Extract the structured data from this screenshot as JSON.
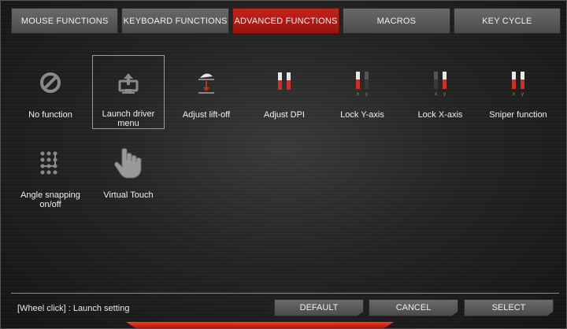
{
  "tabs": [
    {
      "label": "MOUSE FUNCTIONS",
      "active": false
    },
    {
      "label": "KEYBOARD FUNCTIONS",
      "active": false
    },
    {
      "label": "ADVANCED FUNCTIONS",
      "active": true
    },
    {
      "label": "MACROS",
      "active": false
    },
    {
      "label": "KEY CYCLE",
      "active": false
    }
  ],
  "functions": [
    {
      "label": "No function",
      "icon": "no-function-icon"
    },
    {
      "label": "Launch driver menu",
      "icon": "launch-driver-icon",
      "selected": true
    },
    {
      "label": "Adjust lift-off",
      "icon": "lift-off-icon"
    },
    {
      "label": "Adjust DPI",
      "icon": "dpi-sliders-icon"
    },
    {
      "label": "Lock Y-axis",
      "icon": "lock-y-axis-icon"
    },
    {
      "label": "Lock X-axis",
      "icon": "lock-x-axis-icon"
    },
    {
      "label": "Sniper function",
      "icon": "sniper-icon"
    },
    {
      "label": "Angle snapping on/off",
      "icon": "angle-snapping-icon"
    },
    {
      "label": "Virtual Touch",
      "icon": "hand-pointer-icon"
    }
  ],
  "status": {
    "text": "[Wheel click] : Launch setting"
  },
  "buttons": {
    "default": "DEFAULT",
    "cancel": "CANCEL",
    "select": "SELECT"
  },
  "colors": {
    "accent": "#b81b15",
    "tab": "#5a5a5a",
    "icon": "#8a8a8a",
    "icon_red": "#c8302a"
  }
}
